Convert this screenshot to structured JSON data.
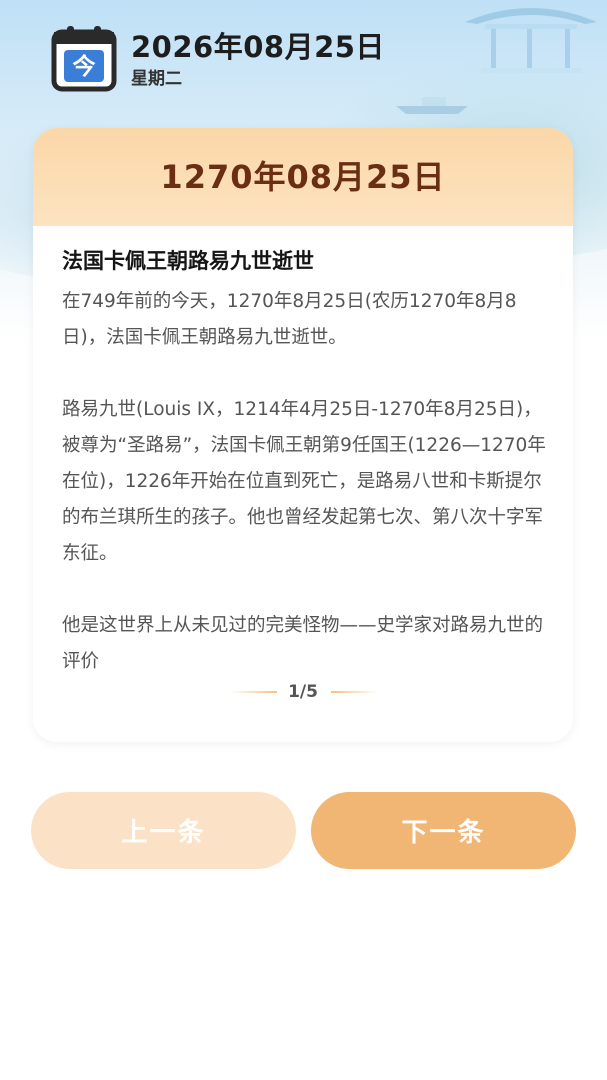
{
  "header": {
    "calendar_icon_char": "今",
    "date": "2026年08月25日",
    "weekday": "星期二"
  },
  "card": {
    "date": "1270年08月25日",
    "event_title": "法国卡佩王朝路易九世逝世",
    "paragraphs": [
      "在749年前的今天，1270年8月25日(农历1270年8月8日)，法国卡佩王朝路易九世逝世。",
      "路易九世(Louis IX，1214年4月25日-1270年8月25日)，被尊为“圣路易”，法国卡佩王朝第9任国王(1226—1270年在位)，1226年开始在位直到死亡，是路易八世和卡斯提尔的布兰琪所生的孩子。他也曾经发起第七次、第八次十字军东征。",
      "他是这世界上从未见过的完美怪物——史学家对路易九世的评价"
    ],
    "pager": "1/5"
  },
  "buttons": {
    "prev_label": "上一条",
    "next_label": "下一条"
  },
  "colors": {
    "accent": "#f1b574",
    "accent_light": "#fbe2c6",
    "card_header": "#fcdcb4",
    "card_date_text": "#6a2e15",
    "calendar_icon_blue": "#3a7ed8"
  }
}
